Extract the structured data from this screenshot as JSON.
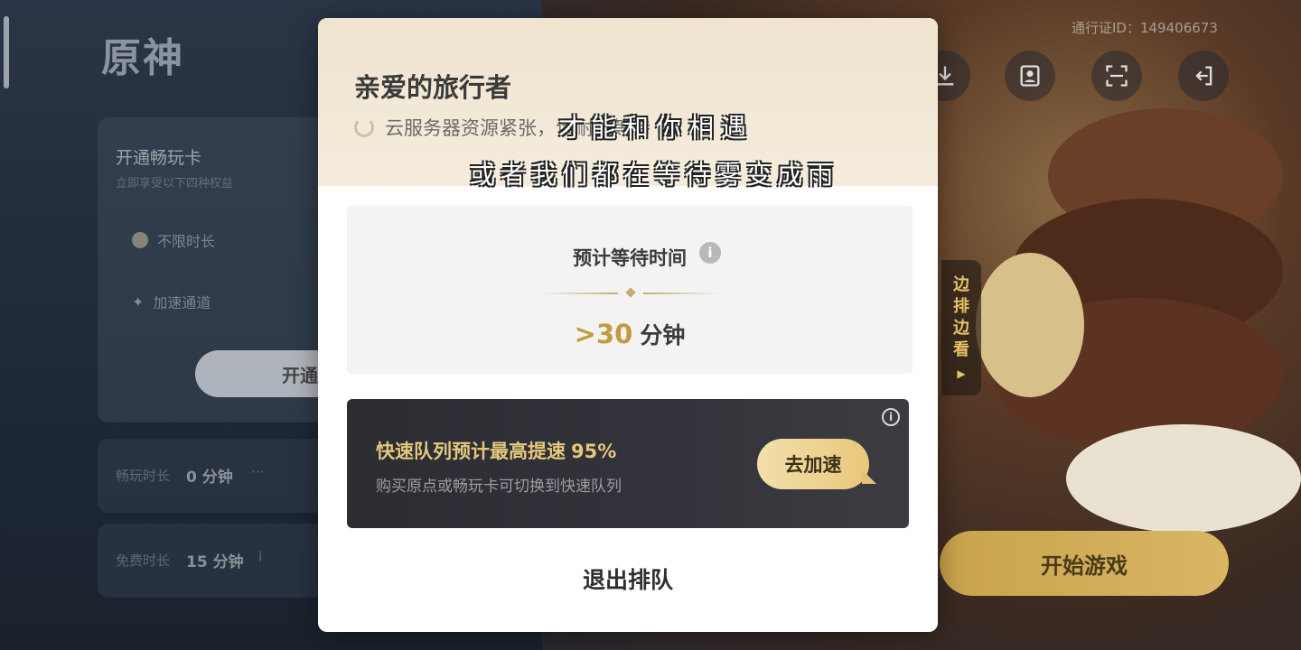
{
  "background": {
    "logo": "原神",
    "uid": "通行证ID：149406673",
    "pass_card": {
      "title": "开通畅玩卡",
      "subtitle": "立即享受以下四种权益",
      "benefits": [
        "不限时长",
        "加速通道"
      ],
      "button": "开通"
    },
    "stats": [
      {
        "label": "畅玩时长",
        "value": "0 分钟",
        "more": "···"
      },
      {
        "label": "免费时长",
        "value": "15 分钟",
        "more": "i"
      }
    ],
    "side_tab": {
      "chars": [
        "边",
        "排",
        "边",
        "看"
      ],
      "arrow": "▶"
    },
    "start_button": "开始游戏",
    "top_icons": [
      "download-icon",
      "profile-icon",
      "scan-icon",
      "exit-icon"
    ]
  },
  "overlay_lyrics": {
    "line1": "才能和你相遇",
    "line2": "或者我们都在等待雾变成雨"
  },
  "modal": {
    "greeting": "亲爱的旅行者",
    "busy_text": "云服务器资源紧张，请耐心等待",
    "wait": {
      "title": "预计等待时间",
      "info": "i",
      "value": ">30",
      "unit": "分钟"
    },
    "fast_queue": {
      "title": "快速队列预计最高提速",
      "percent": "95%",
      "subtitle": "购买原点或畅玩卡可切换到快速队列",
      "button": "去加速",
      "info": "i"
    },
    "exit_button": "退出排队"
  },
  "colors": {
    "gold": "#c39b3f",
    "fast_gold": "#e3c77d",
    "dark_panel": "#2c2d33",
    "modal_header": "#efe4cf"
  }
}
